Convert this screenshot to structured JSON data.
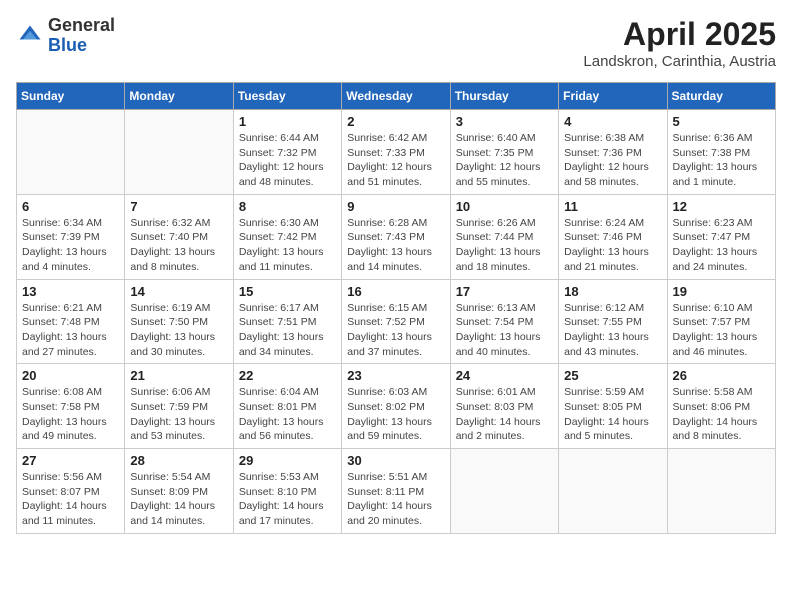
{
  "header": {
    "logo_general": "General",
    "logo_blue": "Blue",
    "month_year": "April 2025",
    "location": "Landskron, Carinthia, Austria"
  },
  "weekdays": [
    "Sunday",
    "Monday",
    "Tuesday",
    "Wednesday",
    "Thursday",
    "Friday",
    "Saturday"
  ],
  "weeks": [
    [
      {
        "day": "",
        "detail": ""
      },
      {
        "day": "",
        "detail": ""
      },
      {
        "day": "1",
        "detail": "Sunrise: 6:44 AM\nSunset: 7:32 PM\nDaylight: 12 hours and 48 minutes."
      },
      {
        "day": "2",
        "detail": "Sunrise: 6:42 AM\nSunset: 7:33 PM\nDaylight: 12 hours and 51 minutes."
      },
      {
        "day": "3",
        "detail": "Sunrise: 6:40 AM\nSunset: 7:35 PM\nDaylight: 12 hours and 55 minutes."
      },
      {
        "day": "4",
        "detail": "Sunrise: 6:38 AM\nSunset: 7:36 PM\nDaylight: 12 hours and 58 minutes."
      },
      {
        "day": "5",
        "detail": "Sunrise: 6:36 AM\nSunset: 7:38 PM\nDaylight: 13 hours and 1 minute."
      }
    ],
    [
      {
        "day": "6",
        "detail": "Sunrise: 6:34 AM\nSunset: 7:39 PM\nDaylight: 13 hours and 4 minutes."
      },
      {
        "day": "7",
        "detail": "Sunrise: 6:32 AM\nSunset: 7:40 PM\nDaylight: 13 hours and 8 minutes."
      },
      {
        "day": "8",
        "detail": "Sunrise: 6:30 AM\nSunset: 7:42 PM\nDaylight: 13 hours and 11 minutes."
      },
      {
        "day": "9",
        "detail": "Sunrise: 6:28 AM\nSunset: 7:43 PM\nDaylight: 13 hours and 14 minutes."
      },
      {
        "day": "10",
        "detail": "Sunrise: 6:26 AM\nSunset: 7:44 PM\nDaylight: 13 hours and 18 minutes."
      },
      {
        "day": "11",
        "detail": "Sunrise: 6:24 AM\nSunset: 7:46 PM\nDaylight: 13 hours and 21 minutes."
      },
      {
        "day": "12",
        "detail": "Sunrise: 6:23 AM\nSunset: 7:47 PM\nDaylight: 13 hours and 24 minutes."
      }
    ],
    [
      {
        "day": "13",
        "detail": "Sunrise: 6:21 AM\nSunset: 7:48 PM\nDaylight: 13 hours and 27 minutes."
      },
      {
        "day": "14",
        "detail": "Sunrise: 6:19 AM\nSunset: 7:50 PM\nDaylight: 13 hours and 30 minutes."
      },
      {
        "day": "15",
        "detail": "Sunrise: 6:17 AM\nSunset: 7:51 PM\nDaylight: 13 hours and 34 minutes."
      },
      {
        "day": "16",
        "detail": "Sunrise: 6:15 AM\nSunset: 7:52 PM\nDaylight: 13 hours and 37 minutes."
      },
      {
        "day": "17",
        "detail": "Sunrise: 6:13 AM\nSunset: 7:54 PM\nDaylight: 13 hours and 40 minutes."
      },
      {
        "day": "18",
        "detail": "Sunrise: 6:12 AM\nSunset: 7:55 PM\nDaylight: 13 hours and 43 minutes."
      },
      {
        "day": "19",
        "detail": "Sunrise: 6:10 AM\nSunset: 7:57 PM\nDaylight: 13 hours and 46 minutes."
      }
    ],
    [
      {
        "day": "20",
        "detail": "Sunrise: 6:08 AM\nSunset: 7:58 PM\nDaylight: 13 hours and 49 minutes."
      },
      {
        "day": "21",
        "detail": "Sunrise: 6:06 AM\nSunset: 7:59 PM\nDaylight: 13 hours and 53 minutes."
      },
      {
        "day": "22",
        "detail": "Sunrise: 6:04 AM\nSunset: 8:01 PM\nDaylight: 13 hours and 56 minutes."
      },
      {
        "day": "23",
        "detail": "Sunrise: 6:03 AM\nSunset: 8:02 PM\nDaylight: 13 hours and 59 minutes."
      },
      {
        "day": "24",
        "detail": "Sunrise: 6:01 AM\nSunset: 8:03 PM\nDaylight: 14 hours and 2 minutes."
      },
      {
        "day": "25",
        "detail": "Sunrise: 5:59 AM\nSunset: 8:05 PM\nDaylight: 14 hours and 5 minutes."
      },
      {
        "day": "26",
        "detail": "Sunrise: 5:58 AM\nSunset: 8:06 PM\nDaylight: 14 hours and 8 minutes."
      }
    ],
    [
      {
        "day": "27",
        "detail": "Sunrise: 5:56 AM\nSunset: 8:07 PM\nDaylight: 14 hours and 11 minutes."
      },
      {
        "day": "28",
        "detail": "Sunrise: 5:54 AM\nSunset: 8:09 PM\nDaylight: 14 hours and 14 minutes."
      },
      {
        "day": "29",
        "detail": "Sunrise: 5:53 AM\nSunset: 8:10 PM\nDaylight: 14 hours and 17 minutes."
      },
      {
        "day": "30",
        "detail": "Sunrise: 5:51 AM\nSunset: 8:11 PM\nDaylight: 14 hours and 20 minutes."
      },
      {
        "day": "",
        "detail": ""
      },
      {
        "day": "",
        "detail": ""
      },
      {
        "day": "",
        "detail": ""
      }
    ]
  ]
}
